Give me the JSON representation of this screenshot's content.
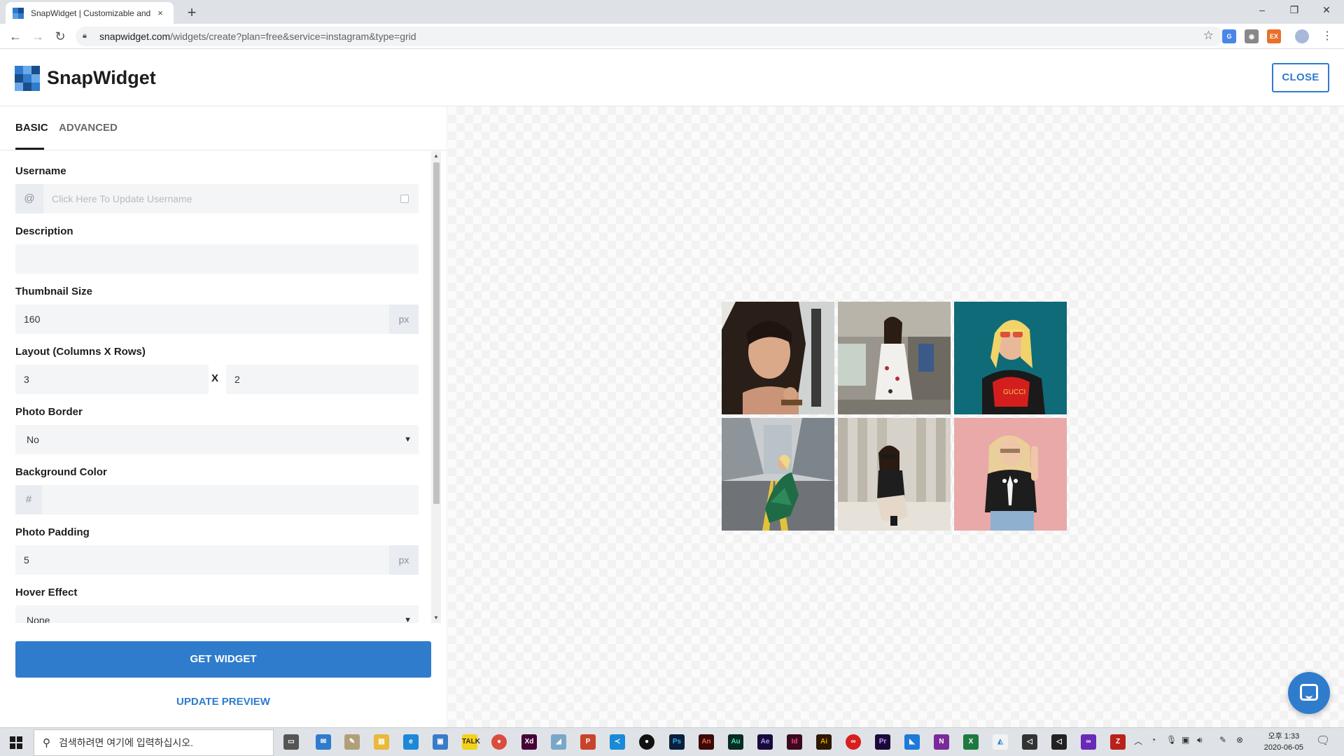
{
  "browser": {
    "tab_title": "SnapWidget | Customizable and",
    "tab_close": "×",
    "new_tab": "+",
    "url_host": "snapwidget.com",
    "url_path": "/widgets/create?plan=free&service=instagram&type=grid",
    "window_controls": {
      "minimize": "–",
      "restore": "❐",
      "close": "✕"
    }
  },
  "header": {
    "brand": "SnapWidget",
    "close_label": "CLOSE"
  },
  "tabs": [
    {
      "label": "BASIC",
      "active": true
    },
    {
      "label": "ADVANCED",
      "active": false
    }
  ],
  "form": {
    "username": {
      "label": "Username",
      "prefix": "@",
      "placeholder": "Click Here To Update Username",
      "value": ""
    },
    "description": {
      "label": "Description",
      "value": ""
    },
    "thumbnail_size": {
      "label": "Thumbnail Size",
      "value": "160",
      "unit": "px"
    },
    "layout": {
      "label": "Layout (Columns X Rows)",
      "columns": "3",
      "separator": "X",
      "rows": "2"
    },
    "photo_border": {
      "label": "Photo Border",
      "selected": "No"
    },
    "background_color": {
      "label": "Background Color",
      "prefix": "#",
      "value": ""
    },
    "photo_padding": {
      "label": "Photo Padding",
      "value": "5",
      "unit": "px"
    },
    "hover_effect": {
      "label": "Hover Effect",
      "selected": "None"
    }
  },
  "actions": {
    "get_widget": "GET WIDGET",
    "update_preview": "UPDATE PREVIEW"
  },
  "preview": {
    "columns": 3,
    "rows": 2,
    "photos": [
      "photo-1",
      "photo-2",
      "photo-3",
      "photo-4",
      "photo-5",
      "photo-6"
    ]
  },
  "taskbar": {
    "search_placeholder": "검색하려면 여기에 입력하십시오.",
    "time": "오후 1:33",
    "date": "2020-06-05"
  },
  "colors": {
    "accent": "#2f7ccd",
    "brand_dark": "#1d1d1d"
  }
}
